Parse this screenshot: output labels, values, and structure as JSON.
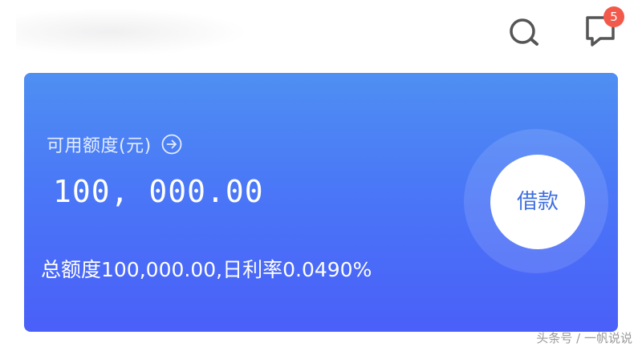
{
  "header": {
    "search_icon": "search-icon",
    "message_icon": "message-icon",
    "message_badge": "5"
  },
  "card": {
    "credit_label": "可用额度(元)",
    "arrow_icon": "arrow-right-circle-icon",
    "available_amount": "100, 000.00",
    "summary": "总额度100,000.00,日利率0.0490%",
    "borrow_label": "借款"
  },
  "watermark": "头条号 / 一帆说说",
  "colors": {
    "card_gradient_top": "#4f8ff2",
    "card_gradient_bottom": "#4a5ff8",
    "badge": "#f2594b",
    "borrow_text": "#3f6fe0",
    "icon_gray": "#555555"
  }
}
